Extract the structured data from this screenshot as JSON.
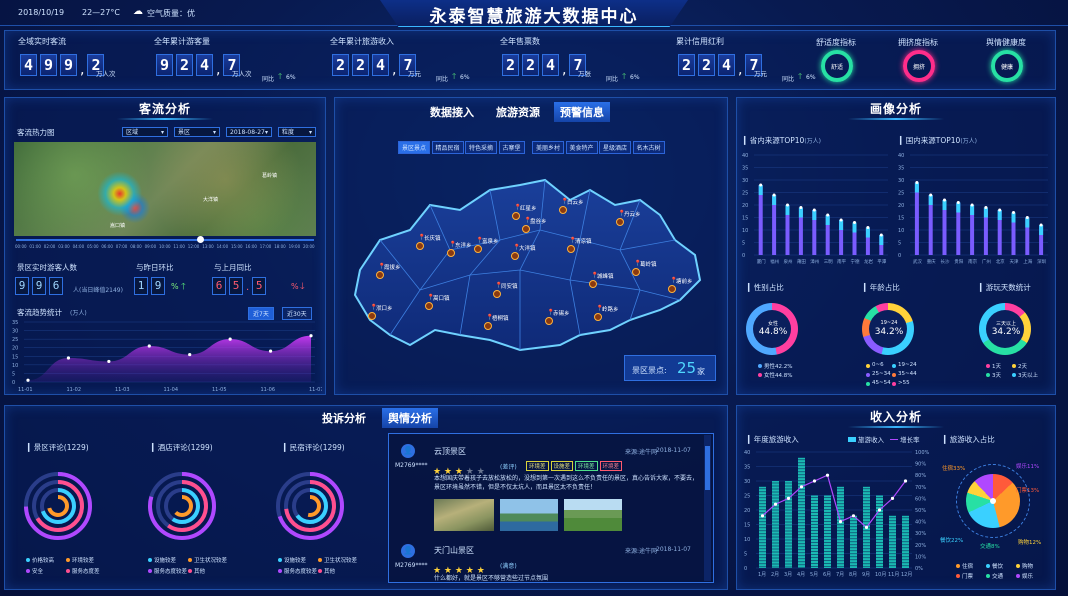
{
  "header": {
    "date": "2018/10/19",
    "temp": "22—27°C",
    "air": "空气质量：优",
    "title": "永泰智慧旅游大数据中心"
  },
  "kpis": [
    {
      "label": "全域实时客流",
      "digits": [
        "4",
        "9",
        "9",
        "2"
      ],
      "sep": 1,
      "unit": "万人次",
      "yoy": ""
    },
    {
      "label": "全年累计游客量",
      "digits": [
        "9",
        "2",
        "4",
        "7"
      ],
      "sep": 2,
      "unit": "万人次",
      "yoy": ""
    },
    {
      "label": "全年累计旅游收入",
      "digits": [
        "2",
        "2",
        "4",
        "7"
      ],
      "sep": 2,
      "unit": "万元",
      "yoy": "同比",
      "yoyval": "6%"
    },
    {
      "label": "全年售票数",
      "digits": [
        "2",
        "2",
        "4",
        "7"
      ],
      "sep": 2,
      "unit": "万张",
      "yoy": "同比",
      "yoyval": "6%"
    },
    {
      "label": "累计信用红利",
      "digits": [
        "2",
        "2",
        "4",
        "7"
      ],
      "sep": 2,
      "unit": "万元",
      "yoy": "同比",
      "yoyval": "6%"
    }
  ],
  "kpi_yoy0": "同比",
  "kpi_yoy0val": "6%",
  "indicators": [
    {
      "label": "舒适度指标",
      "inner": "舒适",
      "color": "#27e0a4"
    },
    {
      "label": "拥挤度指标",
      "inner": "拥挤",
      "color": "#ff2d8a"
    },
    {
      "label": "舆情健康度",
      "inner": "健康",
      "color": "#27e0a4"
    }
  ],
  "flow": {
    "title": "客流分析",
    "heat_label": "客流热力图",
    "sel1": "区域",
    "sel2": "景区",
    "sel3": "2018-08-27",
    "sel4": "粒度",
    "timeline": [
      "00:00",
      "01:00",
      "02:00",
      "03:00",
      "04:00",
      "05:00",
      "06:00",
      "07:00",
      "08:00",
      "09:00",
      "10:00",
      "11:00",
      "12:00",
      "13:00",
      "14:00",
      "15:00",
      "16:00",
      "17:00",
      "18:00",
      "19:00",
      "20:00"
    ],
    "map_labels": [
      "大洋镇",
      "葛岭镇",
      "嵩口镇"
    ],
    "realtime_label": "景区实时游客人数",
    "realtime_digits": [
      "9",
      "9",
      "6"
    ],
    "realtime_note": "人(当日峰值2149)",
    "day_label": "与昨日环比",
    "day_digits": [
      "1",
      "9"
    ],
    "day_unit": "%",
    "month_label": "与上月同比",
    "month_digits": [
      "6",
      "5",
      "5"
    ],
    "month_unit": "%",
    "trend_label": "客流趋势统计",
    "trend_unit": "(万人)",
    "btn7": "近7天",
    "btn30": "近30天"
  },
  "flow_chart": {
    "type": "area",
    "x": [
      "11-01",
      "11-02",
      "11-03",
      "11-04",
      "11-05",
      "11-06",
      "11-07"
    ],
    "values": [
      1,
      14,
      12,
      21,
      16,
      25,
      18,
      27
    ],
    "ylim": [
      0,
      35
    ],
    "yticks": [
      0,
      5,
      10,
      15,
      20,
      25,
      30,
      35
    ]
  },
  "map": {
    "tabs": [
      "数据接入",
      "旅游资源",
      "预警信息"
    ],
    "cats": [
      "景区景点",
      "精品民宿",
      "特色采摘",
      "古寨堡",
      "美丽乡村",
      "美食特产",
      "星级酒店",
      "名木古树"
    ],
    "towns": [
      "红星乡",
      "白云乡",
      "丹云乡",
      "盘谷乡",
      "长庆镇",
      "东洋乡",
      "富泉乡",
      "大洋镇",
      "清凉镇",
      "霞拔乡",
      "葛岭镇",
      "嵩口镇",
      "同安镇",
      "城峰镇",
      "塘前乡",
      "梧桐镇",
      "赤锡乡",
      "岭路乡",
      "洑口乡"
    ],
    "count_label": "景区景点:",
    "count_val": "25",
    "count_unit": "家"
  },
  "profile": {
    "title": "画像分析",
    "top1": "省内来源TOP10",
    "top1u": "(万人)",
    "top2": "国内来源TOP10",
    "top2u": "(万人)",
    "gender": "性别占比",
    "age": "年龄占比",
    "days": "游玩天数统计",
    "gender_center1": "女性",
    "gender_center2": "44.8%",
    "gender_leg": [
      "男性42.2%",
      "女性44.8%"
    ],
    "age_center1": "19~24",
    "age_center2": "34.2%",
    "age_leg": [
      "0~6",
      "19~24",
      "25~34",
      "35~44",
      "45~54",
      ">55"
    ],
    "days_center1": "三天以上",
    "days_center2": "34.2%",
    "days_leg": [
      "1天",
      "2天",
      "3天",
      "3天以上"
    ]
  },
  "chart_top1": {
    "type": "bar",
    "categories": [
      "厦门",
      "福州",
      "泉州",
      "莆田",
      "漳州",
      "三明",
      "南平",
      "宁德",
      "龙岩",
      "平潭"
    ],
    "values": [
      28,
      24,
      20,
      19,
      18,
      16,
      14,
      13,
      11,
      8
    ],
    "ylim": [
      0,
      40
    ]
  },
  "chart_top2": {
    "type": "bar",
    "categories": [
      "武汉",
      "重庆",
      "长沙",
      "贵阳",
      "南京",
      "广州",
      "北京",
      "天津",
      "上海",
      "深圳"
    ],
    "values": [
      29,
      24,
      22,
      21,
      20,
      19,
      18,
      17,
      15,
      12
    ],
    "ylim": [
      0,
      40
    ]
  },
  "complaint": {
    "tabs": [
      "投诉分析",
      "舆情分析"
    ],
    "c1": "景区评论(1229)",
    "c2": "酒店评论(1299)",
    "c3": "民宿评论(1299)",
    "leg1": [
      "价格较高",
      "环境较差",
      "安全",
      "服务态度差"
    ],
    "leg2": [
      "设施较差",
      "卫生状况较差",
      "服务态度较差",
      "其他"
    ],
    "leg3": [
      "设施较差",
      "卫生状况较差",
      "服务态度较差",
      "其他"
    ]
  },
  "reviews": [
    {
      "user": "M2769****",
      "place": "云顶景区",
      "src": "来源:途牛网",
      "date": "2018-11-07",
      "grade": "(差评)",
      "tags": [
        "环境差",
        "设施差",
        "环境差",
        "环境差"
      ],
      "text": "本想国庆带着孩子去放松放松的，没想到第一次遇到这么不负责任的景区，真心告诉大家，不要去，景区环境虽然不错，但是不仅太坑人，而且景区太不负责任！"
    },
    {
      "user": "M2769****",
      "place": "天门山景区",
      "src": "来源:途牛网",
      "date": "2018-11-07",
      "grade": "(满意)",
      "text": "什么都好，就是景区不够营造些过节点氛围"
    }
  ],
  "income": {
    "title": "收入分析",
    "annual": "年度旅游收入",
    "leg_income": "旅游收入",
    "leg_growth": "增长率",
    "share": "旅游收入占比",
    "pie_labels": [
      "住宿33%",
      "娱乐11%",
      "门票13%",
      "购物12%",
      "交通8%",
      "餐饮22%"
    ],
    "pie_leg": [
      "住宿",
      "餐饮",
      "购物",
      "门票",
      "交通",
      "娱乐"
    ]
  },
  "chart_income": {
    "type": "bar",
    "categories": [
      "1月",
      "2月",
      "3月",
      "4月",
      "5月",
      "6月",
      "7月",
      "8月",
      "9月",
      "10月",
      "11月",
      "12月"
    ],
    "values": [
      28,
      30,
      30,
      38,
      25,
      25,
      28,
      18,
      28,
      25,
      18,
      18
    ],
    "growth": [
      45,
      55,
      60,
      70,
      75,
      80,
      40,
      45,
      35,
      50,
      60,
      75
    ],
    "ylim": [
      0,
      40
    ],
    "y2lim": [
      0,
      100
    ]
  }
}
